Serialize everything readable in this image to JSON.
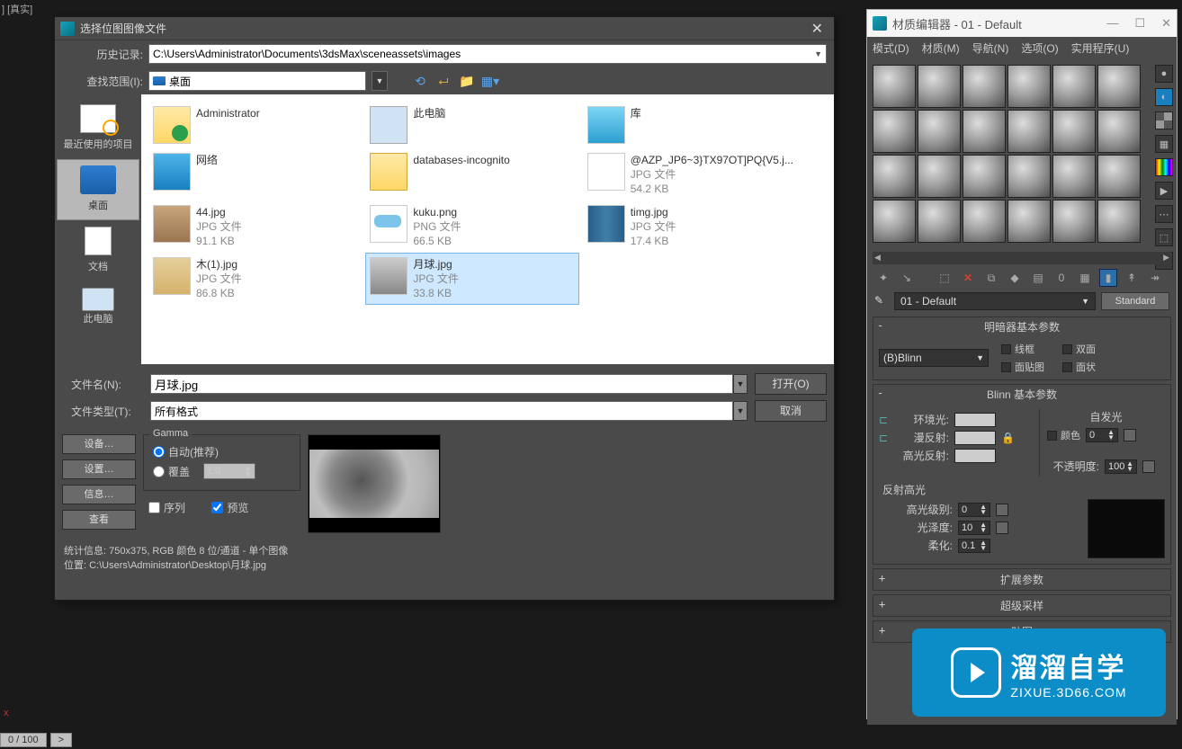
{
  "top_text": "] [真实]",
  "file_dialog": {
    "title": "选择位图图像文件",
    "history_label": "历史记录:",
    "history_value": "C:\\Users\\Administrator\\Documents\\3dsMax\\sceneassets\\images",
    "look_label": "查找范围(I):",
    "look_value": "桌面",
    "sidebar": [
      {
        "label": "最近使用的项目"
      },
      {
        "label": "桌面"
      },
      {
        "label": "文档"
      },
      {
        "label": "此电脑"
      }
    ],
    "items": [
      {
        "name": "Administrator",
        "sub1": "",
        "sub2": ""
      },
      {
        "name": "此电脑",
        "sub1": "",
        "sub2": ""
      },
      {
        "name": "库",
        "sub1": "",
        "sub2": ""
      },
      {
        "name": "网络",
        "sub1": "",
        "sub2": ""
      },
      {
        "name": "databases-incognito",
        "sub1": "",
        "sub2": ""
      },
      {
        "name": "@AZP_JP6~3}TX97OT]PQ{V5.j...",
        "sub1": "JPG 文件",
        "sub2": "54.2 KB"
      },
      {
        "name": "44.jpg",
        "sub1": "JPG 文件",
        "sub2": "91.1 KB"
      },
      {
        "name": "kuku.png",
        "sub1": "PNG 文件",
        "sub2": "66.5 KB"
      },
      {
        "name": "timg.jpg",
        "sub1": "JPG 文件",
        "sub2": "17.4 KB"
      },
      {
        "name": "木(1).jpg",
        "sub1": "JPG 文件",
        "sub2": "86.8 KB"
      },
      {
        "name": "月球.jpg",
        "sub1": "JPG 文件",
        "sub2": "33.8 KB"
      }
    ],
    "filename_label": "文件名(N):",
    "filename_value": "月球.jpg",
    "filetype_label": "文件类型(T):",
    "filetype_value": "所有格式",
    "open_btn": "打开(O)",
    "cancel_btn": "取消",
    "device_btn": "设备…",
    "setup_btn": "设置…",
    "info_btn": "信息…",
    "view_btn": "查看",
    "gamma_title": "Gamma",
    "gamma_auto": "自动(推荐)",
    "gamma_override": "覆盖",
    "gamma_value": "1.0",
    "seq_label": "序列",
    "preview_label": "预览",
    "stats": "统计信息:  750x375, RGB 颜色 8 位/通道 - 单个图像",
    "location": "位置:  C:\\Users\\Administrator\\Desktop\\月球.jpg"
  },
  "mat": {
    "title": "材质编辑器 - 01 - Default",
    "menu": [
      "模式(D)",
      "材质(M)",
      "导航(N)",
      "选项(O)",
      "实用程序(U)"
    ],
    "name": "01 - Default",
    "std_btn": "Standard",
    "sec_basic": "明暗器基本参数",
    "shader": "(B)Blinn",
    "chk_wire": "线框",
    "chk_2side": "双面",
    "chk_facemap": "面贴图",
    "chk_faceted": "面状",
    "sec_blinn": "Blinn 基本参数",
    "self_illum": "自发光",
    "color_chk": "颜色",
    "color_val": "0",
    "ambient": "环境光:",
    "diffuse": "漫反射:",
    "specular": "高光反射:",
    "opacity": "不透明度:",
    "opacity_val": "100",
    "spec_hl_title": "反射高光",
    "spec_level": "高光级别:",
    "spec_level_val": "0",
    "gloss": "光泽度:",
    "gloss_val": "10",
    "soften": "柔化:",
    "soften_val": "0.1",
    "rolls": [
      "扩展参数",
      "超级采样",
      "贴图"
    ]
  },
  "watermark": {
    "cn": "溜溜自学",
    "en": "ZIXUE.3D66.COM"
  },
  "status": {
    "frames": "0 / 100",
    "arrow": ">"
  }
}
